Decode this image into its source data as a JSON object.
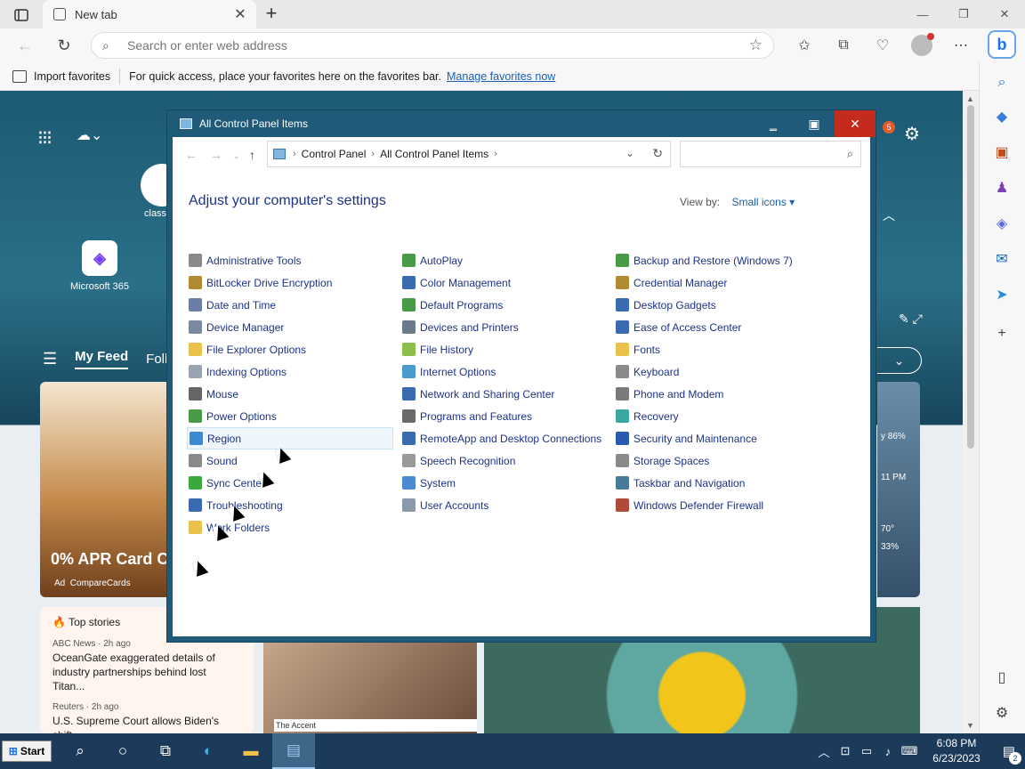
{
  "browser": {
    "tab_title": "New tab",
    "address_placeholder": "Search or enter web address",
    "favbar": {
      "import_label": "Import favorites",
      "hint": "For quick access, place your favorites here on the favorites bar.",
      "manage_link": "Manage favorites now"
    }
  },
  "newtab": {
    "ms365_label": "Microsoft 365",
    "class_label": "class",
    "notification_count": "5",
    "feed_tabs": [
      "My Feed",
      "Follo"
    ],
    "promo_title": "0% APR Card C",
    "promo_ad": "Ad",
    "promo_source": "CompareCards",
    "top_stories": {
      "title": "Top stories",
      "items": [
        {
          "source": "ABC News · 2h ago",
          "headline": "OceanGate exaggerated details of industry partnerships behind lost Titan..."
        },
        {
          "source": "Reuters · 2h ago",
          "headline": "U.S. Supreme Court allows Biden's shift"
        }
      ]
    },
    "photo_caption": "The Accent",
    "weather": {
      "humidity": "y 86%",
      "time": "11 PM",
      "temp": "70°",
      "precip": "33%"
    }
  },
  "control_panel": {
    "title": "All Control Panel Items",
    "breadcrumb": [
      "Control Panel",
      "All Control Panel Items"
    ],
    "heading": "Adjust your computer's settings",
    "view_by_label": "View by:",
    "view_by_value": "Small icons",
    "columns": [
      [
        {
          "label": "Administrative Tools",
          "color": "#8a8a8a"
        },
        {
          "label": "BitLocker Drive Encryption",
          "color": "#b08a2e"
        },
        {
          "label": "Date and Time",
          "color": "#6b7fa6"
        },
        {
          "label": "Device Manager",
          "color": "#7a8aa0"
        },
        {
          "label": "File Explorer Options",
          "color": "#e8c24a"
        },
        {
          "label": "Indexing Options",
          "color": "#9aa4b0"
        },
        {
          "label": "Mouse",
          "color": "#666666"
        },
        {
          "label": "Power Options",
          "color": "#4a9a4a"
        },
        {
          "label": "Region",
          "color": "#3a8ad0"
        },
        {
          "label": "Sound",
          "color": "#8a8a8a"
        },
        {
          "label": "Sync Center",
          "color": "#3aa83a"
        },
        {
          "label": "Troubleshooting",
          "color": "#3a6ab0"
        },
        {
          "label": "Work Folders",
          "color": "#e8c24a"
        }
      ],
      [
        {
          "label": "AutoPlay",
          "color": "#4a9a4a"
        },
        {
          "label": "Color Management",
          "color": "#3a6ab0"
        },
        {
          "label": "Default Programs",
          "color": "#4a9a4a"
        },
        {
          "label": "Devices and Printers",
          "color": "#6a7a8a"
        },
        {
          "label": "File History",
          "color": "#8ac04a"
        },
        {
          "label": "Internet Options",
          "color": "#4a9ad0"
        },
        {
          "label": "Network and Sharing Center",
          "color": "#3a6ab0"
        },
        {
          "label": "Programs and Features",
          "color": "#6a6a6a"
        },
        {
          "label": "RemoteApp and Desktop Connections",
          "color": "#3a6ab0"
        },
        {
          "label": "Speech Recognition",
          "color": "#9a9a9a"
        },
        {
          "label": "System",
          "color": "#4a8ad0"
        },
        {
          "label": "User Accounts",
          "color": "#8a9aaa"
        }
      ],
      [
        {
          "label": "Backup and Restore (Windows 7)",
          "color": "#4a9a4a"
        },
        {
          "label": "Credential Manager",
          "color": "#b08a2e"
        },
        {
          "label": "Desktop Gadgets",
          "color": "#3a6ab0"
        },
        {
          "label": "Ease of Access Center",
          "color": "#3a6ab0"
        },
        {
          "label": "Fonts",
          "color": "#e8c24a"
        },
        {
          "label": "Keyboard",
          "color": "#8a8a8a"
        },
        {
          "label": "Phone and Modem",
          "color": "#7a7a7a"
        },
        {
          "label": "Recovery",
          "color": "#3aa8a0"
        },
        {
          "label": "Security and Maintenance",
          "color": "#2a5ab0"
        },
        {
          "label": "Storage Spaces",
          "color": "#8a8a8a"
        },
        {
          "label": "Taskbar and Navigation",
          "color": "#4a7a9a"
        },
        {
          "label": "Windows Defender Firewall",
          "color": "#b04a3a"
        }
      ]
    ],
    "selected_item": "Region"
  },
  "taskbar": {
    "start_label": "Start",
    "time": "6:08 PM",
    "date": "6/23/2023",
    "notification_badge": "2"
  }
}
